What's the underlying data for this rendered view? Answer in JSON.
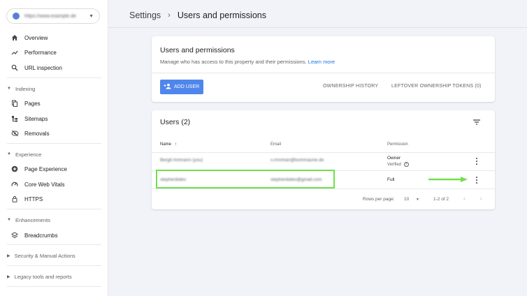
{
  "property": {
    "url": "https://www.example.de",
    "dropdown_icon": "caret-down-icon"
  },
  "sidebar": {
    "top_items": [
      {
        "label": "Overview",
        "icon": "home-icon"
      },
      {
        "label": "Performance",
        "icon": "trending-icon"
      },
      {
        "label": "URL inspection",
        "icon": "search-icon"
      }
    ],
    "indexing": {
      "title": "Indexing",
      "items": [
        {
          "label": "Pages",
          "icon": "pages-icon"
        },
        {
          "label": "Sitemaps",
          "icon": "sitemap-icon"
        },
        {
          "label": "Removals",
          "icon": "eye-off-icon"
        }
      ]
    },
    "experience": {
      "title": "Experience",
      "items": [
        {
          "label": "Page Experience",
          "icon": "plus-circle-icon"
        },
        {
          "label": "Core Web Vitals",
          "icon": "gauge-icon"
        },
        {
          "label": "HTTPS",
          "icon": "lock-icon"
        }
      ]
    },
    "enhancements": {
      "title": "Enhancements",
      "items": [
        {
          "label": "Breadcrumbs",
          "icon": "layers-icon"
        }
      ]
    },
    "security": {
      "title": "Security & Manual Actions"
    },
    "legacy": {
      "title": "Legacy tools and reports"
    }
  },
  "breadcrumb": {
    "parent": "Settings",
    "current": "Users and permissions"
  },
  "users_card": {
    "title": "Users and permissions",
    "description": "Manage who has access to this property and their permissions.",
    "learn_more": "Learn more",
    "add_user": "ADD USER",
    "ownership_history": "OWNERSHIP HISTORY",
    "leftover_tokens": "LEFTOVER OWNERSHIP TOKENS (0)"
  },
  "users_table": {
    "title": "Users (2)",
    "columns": {
      "name": "Name",
      "email": "Email",
      "permission": "Permission"
    },
    "rows": [
      {
        "name": "Bergit Ammann (you)",
        "email": "s.mmman@kommaune.de",
        "permission": "Owner",
        "status": "Verified"
      },
      {
        "name": "stephenbdev",
        "email": "stephenbdev@gmail.com",
        "permission": "Full",
        "status": ""
      }
    ],
    "rows_per_page_label": "Rows per page:",
    "rows_per_page_value": "10",
    "range": "1-2 of 2"
  },
  "colors": {
    "accent": "#4f86ec",
    "highlight": "#6fe14a"
  }
}
